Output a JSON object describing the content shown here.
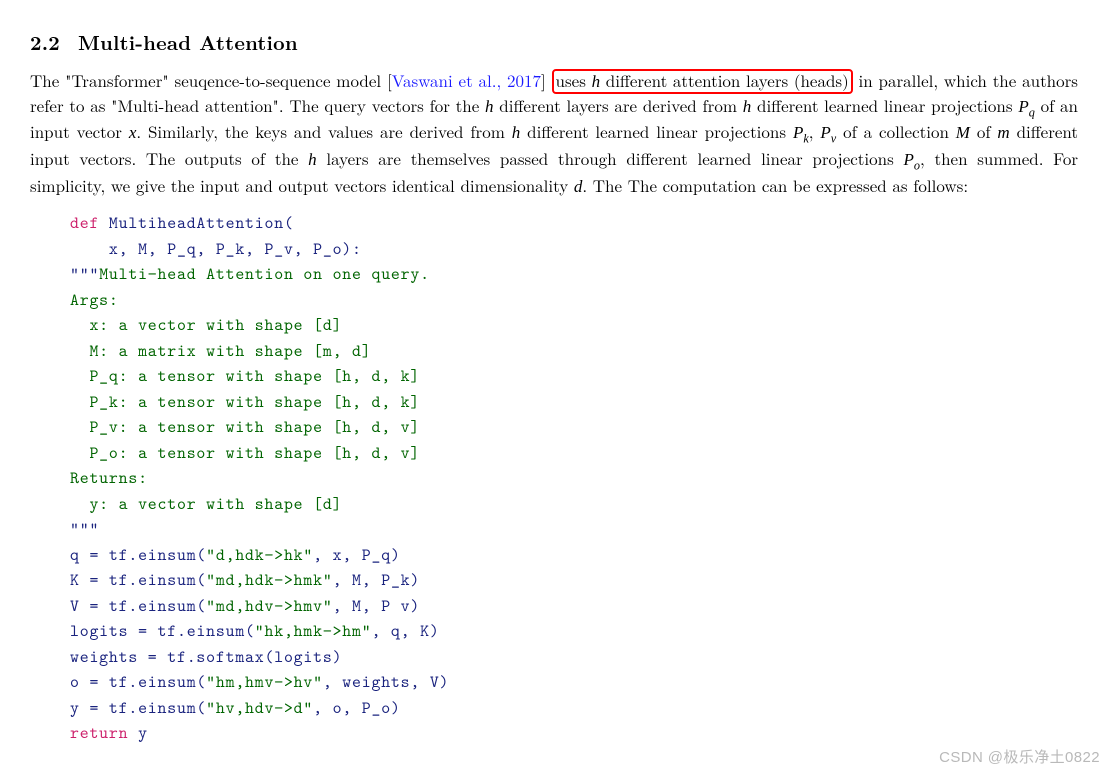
{
  "section": {
    "number": "2.2",
    "title": "Multi-head Attention"
  },
  "paragraph": {
    "pre_cite": "The \"Transformer\" seuqence-to-sequence model [",
    "citation": "Vaswani et al., 2017",
    "post_cite_a": "] ",
    "highlighted_a": "uses ",
    "highlighted_b": " different attention layers (heads)",
    "cont_a": " in parallel, which the authors refer to as \"Multi-head attention\". The query vectors for the ",
    "cont_b": " different layers are derived from ",
    "cont_c": " different learned linear projections ",
    "cont_d": " of an input vector ",
    "cont_e": ". Similarly, the keys and values are derived from ",
    "cont_f": " different learned linear projections ",
    "cont_g": " of a collection ",
    "cont_h": " of ",
    "cont_i": " different input vectors. The outputs of the ",
    "cont_j": " layers are themselves passed through different learned linear projections ",
    "cont_k": ", then summed. For simplicity, we give the input and output vectors identical dimensionality ",
    "cont_l": ". The The computation can be expressed as follows:"
  },
  "sym": {
    "h": "h",
    "h2": "h",
    "h3": "h",
    "h4": "h",
    "h5": "h",
    "Pq": "P",
    "q": "q",
    "x": "x",
    "Pk": "P",
    "k": "k",
    "Pv": "P",
    "v": "v",
    "M": "M",
    "m": "m",
    "Po": "P",
    "o": "o",
    "d": "d"
  },
  "code": {
    "l01_def": "def",
    "l01_name": " MultiheadAttention(",
    "l02": "    x, M, P_q, P_k, P_v, P_o):",
    "l03_q": "\"\"\"",
    "l03_t": "Multi−head Attention on one query.",
    "l04": "Args:",
    "l05": "  x: a vector with shape [d]",
    "l06": "  M: a matrix with shape [m, d]",
    "l07": "  P_q: a tensor with shape [h, d, k]",
    "l08": "  P_k: a tensor with shape [h, d, k]",
    "l09": "  P_v: a tensor with shape [h, d, v]",
    "l10": "  P_o: a tensor with shape [h, d, v]",
    "l11": "Returns:",
    "l12": "  y: a vector with shape [d]",
    "l13": "\"\"\"",
    "l14a": "q = tf.einsum(",
    "l14s": "\"d,hdk−>hk\"",
    "l14b": ", x, P_q)",
    "l15a": "K = tf.einsum(",
    "l15s": "\"md,hdk−>hmk\"",
    "l15b": ", M, P_k)",
    "l16a": "V = tf.einsum(",
    "l16s": "\"md,hdv−>hmv\"",
    "l16b": ", M, P v)",
    "l17a": "logits = tf.einsum(",
    "l17s": "\"hk,hmk−>hm\"",
    "l17b": ", q, K)",
    "l18": "weights = tf.softmax(logits)",
    "l19a": "o = tf.einsum(",
    "l19s": "\"hm,hmv−>hv\"",
    "l19b": ", weights, V)",
    "l20a": "y = tf.einsum(",
    "l20s": "\"hv,hdv−>d\"",
    "l20b": ", o, P_o)",
    "l21_kw": "return",
    "l21_id": " y"
  },
  "watermark": "CSDN @极乐净土0822"
}
